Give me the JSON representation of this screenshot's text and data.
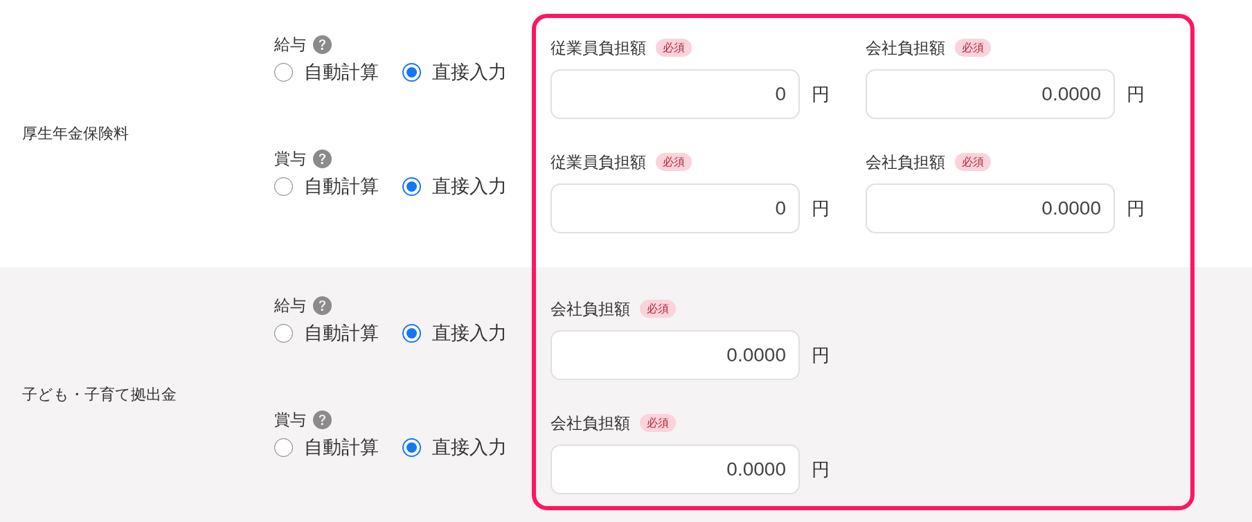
{
  "sections": [
    {
      "label": "厚生年金保険料",
      "items": [
        {
          "title": "給与",
          "options": [
            {
              "label": "自動計算",
              "selected": false
            },
            {
              "label": "直接入力",
              "selected": true
            }
          ],
          "fields": [
            {
              "label": "従業員負担額",
              "badge": "必須",
              "value": "0",
              "unit": "円"
            },
            {
              "label": "会社負担額",
              "badge": "必須",
              "value": "0.0000",
              "unit": "円"
            }
          ]
        },
        {
          "title": "賞与",
          "options": [
            {
              "label": "自動計算",
              "selected": false
            },
            {
              "label": "直接入力",
              "selected": true
            }
          ],
          "fields": [
            {
              "label": "従業員負担額",
              "badge": "必須",
              "value": "0",
              "unit": "円"
            },
            {
              "label": "会社負担額",
              "badge": "必須",
              "value": "0.0000",
              "unit": "円"
            }
          ]
        }
      ]
    },
    {
      "label": "子ども・子育て拠出金",
      "items": [
        {
          "title": "給与",
          "options": [
            {
              "label": "自動計算",
              "selected": false
            },
            {
              "label": "直接入力",
              "selected": true
            }
          ],
          "fields": [
            {
              "label": "会社負担額",
              "badge": "必須",
              "value": "0.0000",
              "unit": "円"
            }
          ]
        },
        {
          "title": "賞与",
          "options": [
            {
              "label": "自動計算",
              "selected": false
            },
            {
              "label": "直接入力",
              "selected": true
            }
          ],
          "fields": [
            {
              "label": "会社負担額",
              "badge": "必須",
              "value": "0.0000",
              "unit": "円"
            }
          ]
        }
      ]
    }
  ]
}
